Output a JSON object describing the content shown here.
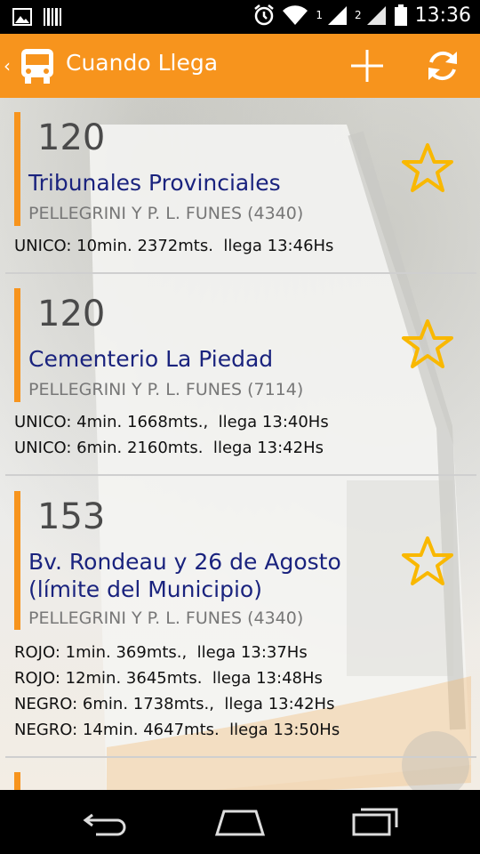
{
  "status_bar": {
    "time": "13:36",
    "sim1": "1",
    "sim2": "2",
    "icons": [
      "image-icon",
      "barcode-icon",
      "alarm-icon",
      "wifi-icon",
      "signal-icon",
      "signal-icon",
      "battery-icon"
    ]
  },
  "action_bar": {
    "title": "Cuando Llega",
    "icons": [
      "bus-logo-icon",
      "add-icon",
      "refresh-icon"
    ],
    "color": "#f7941d"
  },
  "cards": [
    {
      "route": "120",
      "destination": "Tribunales Provinciales",
      "stop": "PELLEGRINI Y P. L. FUNES (4340)",
      "arrivals": [
        "UNICO: 10min. 2372mts.  llega 13:46Hs"
      ]
    },
    {
      "route": "120",
      "destination": "Cementerio La Piedad",
      "stop": "PELLEGRINI Y P. L. FUNES (7114)",
      "arrivals": [
        "UNICO: 4min. 1668mts.,  llega 13:40Hs",
        "UNICO: 6min. 2160mts.  llega 13:42Hs"
      ]
    },
    {
      "route": "153",
      "destination": "Bv. Rondeau y 26 de Agosto (límite del Municipio)",
      "stop": "PELLEGRINI Y P. L. FUNES (4340)",
      "arrivals": [
        "ROJO: 1min. 369mts.,  llega 13:37Hs",
        "ROJO: 12min. 3645mts.  llega 13:48Hs",
        "NEGRO: 6min. 1738mts.,  llega 13:42Hs",
        "NEGRO: 14min. 4647mts.  llega 13:50Hs"
      ]
    }
  ],
  "colors": {
    "accent": "#f7941d",
    "star": "#f9b800",
    "destination": "#1a237e"
  }
}
